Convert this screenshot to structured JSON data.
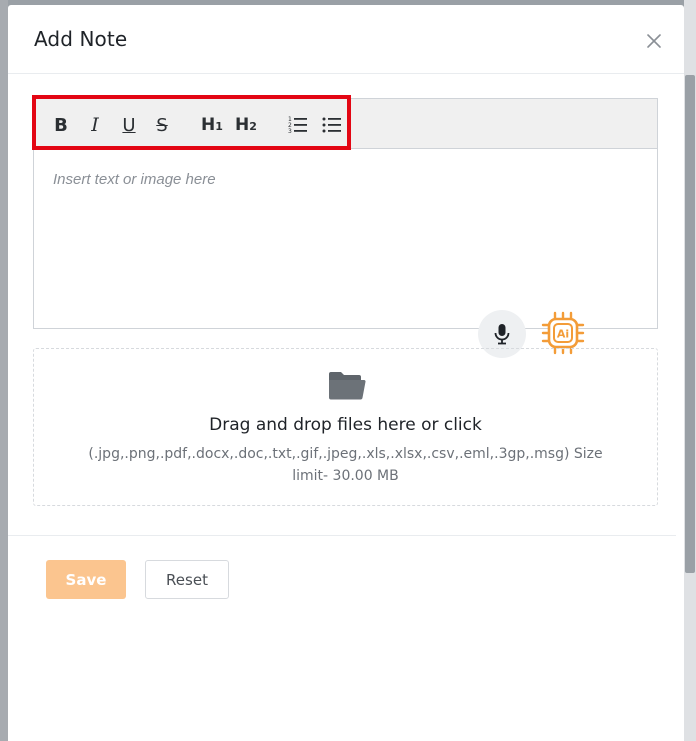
{
  "modal": {
    "title": "Add Note",
    "close_icon": "close-icon"
  },
  "toolbar": {
    "bold_label": "B",
    "italic_label": "I",
    "underline_label": "U",
    "strike_label": "S",
    "h1_label": "H",
    "h1_sub": "1",
    "h2_label": "H",
    "h2_sub": "2",
    "ordered_list_icon": "ordered-list-icon",
    "bullet_list_icon": "bullet-list-icon",
    "highlight_color": "#e30613"
  },
  "editor": {
    "placeholder": "Insert text or image here"
  },
  "actions": {
    "mic_icon": "microphone-icon",
    "ai_icon": "ai-chip-icon",
    "ai_label": "Ai",
    "ai_color": "#f39c38"
  },
  "dropzone": {
    "folder_icon": "folder-icon",
    "title": "Drag and drop files here or click",
    "subtitle": "(.jpg,.png,.pdf,.docx,.doc,.txt,.gif,.jpeg,.xls,.xlsx,.csv,.eml,.3gp,.msg) Size limit- 30.00 MB"
  },
  "footer": {
    "save_label": "Save",
    "reset_label": "Reset",
    "save_color": "#fbc58f"
  }
}
